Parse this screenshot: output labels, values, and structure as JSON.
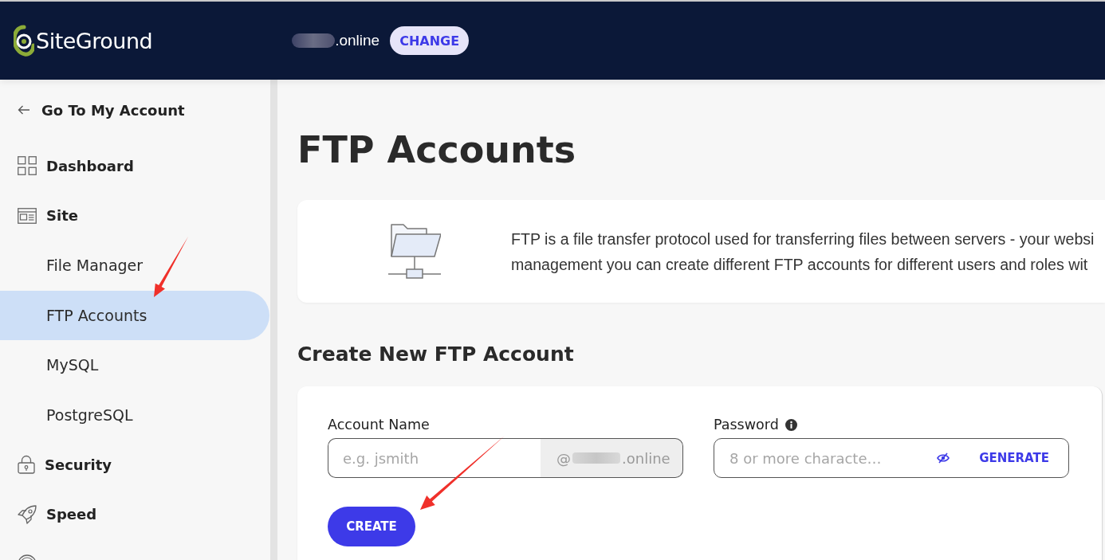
{
  "header": {
    "logo": "SiteGround",
    "domain": ".online",
    "change_button": "CHANGE"
  },
  "sidebar": {
    "back_link": "Go To My Account",
    "items": [
      {
        "label": "Dashboard",
        "selected": false
      },
      {
        "label": "Site",
        "selected": false,
        "children": [
          {
            "label": "File Manager",
            "selected": false
          },
          {
            "label": "FTP Accounts",
            "selected": true
          },
          {
            "label": "MySQL",
            "selected": false
          },
          {
            "label": "PostgreSQL",
            "selected": false
          }
        ]
      },
      {
        "label": "Security",
        "selected": false
      },
      {
        "label": "Speed",
        "selected": false
      },
      {
        "selected": false
      }
    ]
  },
  "page_title": "FTP Accounts",
  "info_card": {
    "description_lines": [
      "FTP is a file transfer protocol used for transferring files between servers - your websi",
      "management you can create different FTP accounts for different users and roles wit"
    ]
  },
  "create_form": {
    "heading": "Create New FTP Account",
    "fields": [
      {
        "kind": "account",
        "label": "Account Name",
        "placeholder": "e.g. jsmith",
        "suffix_start": "@",
        "suffix_end": ".online"
      },
      {
        "kind": "password",
        "label": "Password",
        "placeholder": "8 or more characte…",
        "action": "GENERATE"
      }
    ],
    "submit_button": "CREATE"
  }
}
